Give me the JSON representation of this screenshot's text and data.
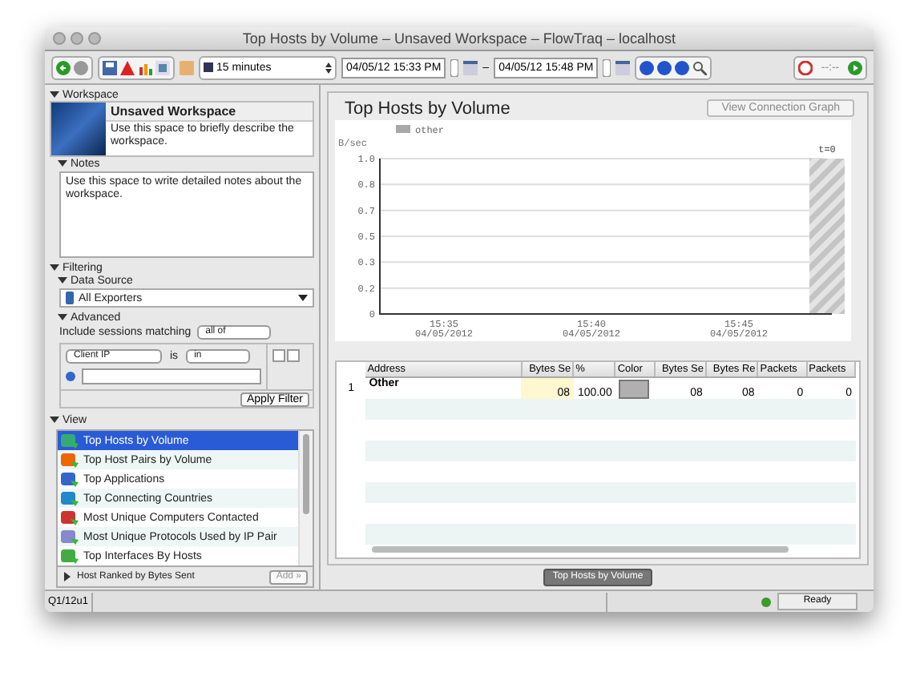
{
  "window": {
    "title": "Top Hosts by Volume – Unsaved Workspace – FlowTraq – localhost"
  },
  "toolbar": {
    "time_range": "15 minutes",
    "start": "04/05/12 15:33 PM",
    "separator": "–",
    "end": "04/05/12 15:48 PM",
    "progress": "--:--"
  },
  "workspace": {
    "heading": "Workspace",
    "name": "Unsaved Workspace",
    "description": "Use this space to briefly describe the workspace."
  },
  "notes": {
    "heading": "Notes",
    "text": "Use this space to write detailed notes about the workspace."
  },
  "filtering": {
    "heading": "Filtering",
    "data_source_heading": "Data Source",
    "data_source": "All Exporters",
    "advanced_heading": "Advanced",
    "match_label": "Include sessions matching",
    "match": "all of",
    "field": "Client IP",
    "operator_label": "is",
    "operator": "in",
    "apply": "Apply Filter"
  },
  "view": {
    "heading": "View",
    "items": [
      {
        "label": "Top Hosts by Volume",
        "selected": true
      },
      {
        "label": "Top Host Pairs by Volume",
        "selected": false
      },
      {
        "label": "Top Applications",
        "selected": false
      },
      {
        "label": "Top Connecting Countries",
        "selected": false
      },
      {
        "label": "Most Unique Computers Contacted",
        "selected": false
      },
      {
        "label": "Most Unique Protocols Used by IP Pair",
        "selected": false
      },
      {
        "label": "Top Interfaces By Hosts",
        "selected": false
      }
    ],
    "subview": "Host Ranked by Bytes Sent",
    "add": "Add »"
  },
  "panel": {
    "title": "Top Hosts by Volume",
    "graph_button": "View Connection Graph",
    "chart": {
      "legend": [
        {
          "name": "other",
          "color": "#a8a8a8"
        }
      ],
      "ylabel": "B/sec",
      "yticks": [
        "1.0",
        "0.8",
        "0.7",
        "0.5",
        "0.3",
        "0.2",
        "0"
      ],
      "xticks": [
        {
          "time": "15:35",
          "date": "04/05/2012"
        },
        {
          "time": "15:40",
          "date": "04/05/2012"
        },
        {
          "time": "15:45",
          "date": "04/05/2012"
        }
      ],
      "marker": "t=0"
    }
  },
  "table": {
    "columns": [
      "Address",
      "Bytes Se",
      "%",
      "Color",
      "Bytes Se",
      "Bytes Re",
      "Packets",
      "Packets"
    ],
    "rows": [
      {
        "number": "1",
        "cells": [
          "Other",
          "08",
          "100.00",
          "",
          "08",
          "08",
          "0",
          "0"
        ],
        "color": "#b0b0b0"
      }
    ]
  },
  "bottom_tab": "Top Hosts by Volume",
  "status_bar": {
    "left": "Q1/12u1",
    "status": "Ready"
  }
}
